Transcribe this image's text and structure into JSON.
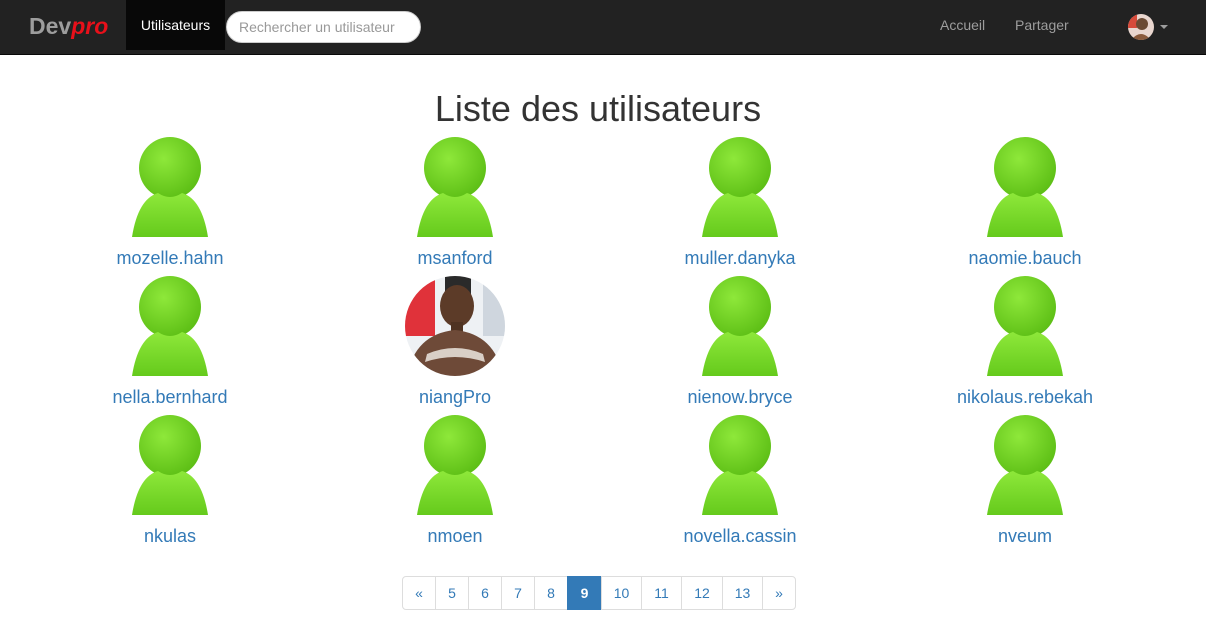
{
  "navbar": {
    "brand_dev": "Dev",
    "brand_pro": "pro",
    "active_item": "Utilisateurs",
    "search_placeholder": "Rechercher un utilisateur",
    "links": [
      "Accueil",
      "Partager"
    ]
  },
  "page": {
    "title": "Liste des utilisateurs"
  },
  "users": [
    {
      "name": "mozelle.hahn",
      "avatar": "default-user-icon"
    },
    {
      "name": "msanford",
      "avatar": "default-user-icon"
    },
    {
      "name": "muller.danyka",
      "avatar": "default-user-icon"
    },
    {
      "name": "naomie.bauch",
      "avatar": "default-user-icon"
    },
    {
      "name": "nella.bernhard",
      "avatar": "default-user-icon"
    },
    {
      "name": "niangPro",
      "avatar": "profile-photo"
    },
    {
      "name": "nienow.bryce",
      "avatar": "default-user-icon"
    },
    {
      "name": "nikolaus.rebekah",
      "avatar": "default-user-icon"
    },
    {
      "name": "nkulas",
      "avatar": "default-user-icon"
    },
    {
      "name": "nmoen",
      "avatar": "default-user-icon"
    },
    {
      "name": "novella.cassin",
      "avatar": "default-user-icon"
    },
    {
      "name": "nveum",
      "avatar": "default-user-icon"
    }
  ],
  "pagination": {
    "prev": "«",
    "next": "»",
    "pages": [
      "5",
      "6",
      "7",
      "8",
      "9",
      "10",
      "11",
      "12",
      "13"
    ],
    "current": "9"
  },
  "colors": {
    "navbar_bg": "#222222",
    "brand_accent": "#e8101a",
    "link": "#337ab7",
    "user_icon_green": "#6cd11f"
  }
}
